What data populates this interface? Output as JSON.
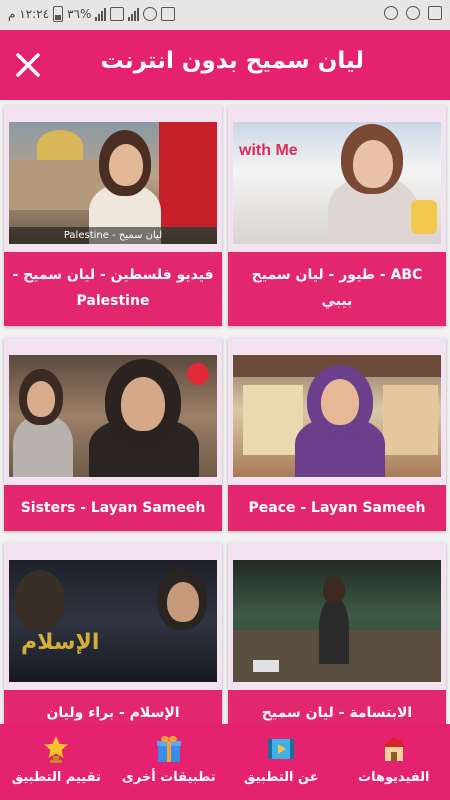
{
  "status_bar": {
    "time": "١٢:٢٤ م",
    "battery_percent": "٣٦%"
  },
  "app_bar": {
    "title": "ليان سميح بدون انترنت",
    "close_icon": "close-icon"
  },
  "videos": [
    {
      "title": "ABC - طيور - ليان سميح بيبي",
      "thumb_text": "with Me"
    },
    {
      "title": "فيديو فلسطين - ليان سميح - Palestine",
      "thumb_text": "Palestine - ليان سميح"
    },
    {
      "title": "Peace - Layan Sameeh",
      "thumb_text": ""
    },
    {
      "title": "Sisters - Layan Sameeh",
      "thumb_text": ""
    },
    {
      "title": "الابتسامة - ليان سميح",
      "thumb_text": ""
    },
    {
      "title": "الإسلام - براء وليان",
      "thumb_text": "الإسلام"
    }
  ],
  "bottom_nav": {
    "items": [
      {
        "label": "الفيديوهات",
        "icon": "house-icon"
      },
      {
        "label": "عن التطبيق",
        "icon": "film-icon"
      },
      {
        "label": "تطبيقات أخرى",
        "icon": "gift-icon"
      },
      {
        "label": "تقييم التطبيق",
        "icon": "star-trophy-icon"
      }
    ]
  },
  "colors": {
    "primary": "#e4226f",
    "card_thumb_bg": "#f3e2ef",
    "status_bar": "#e6e6e6"
  }
}
